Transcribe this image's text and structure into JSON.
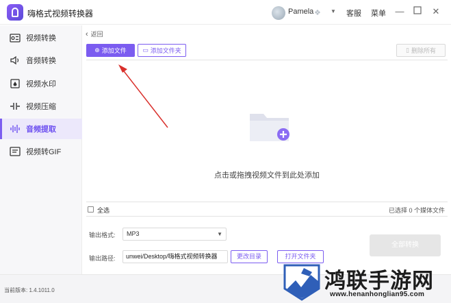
{
  "titlebar": {
    "app_title": "嗨格式视频转换器",
    "user_name": "Pamela",
    "vip_icon": "diamond-icon",
    "support_label": "客服",
    "menu_label": "菜单",
    "window_controls": [
      "minimize-icon",
      "maximize-icon",
      "close-icon"
    ]
  },
  "sidebar": {
    "items": [
      {
        "label": "视频转换",
        "icon": "video-convert-icon",
        "active": false
      },
      {
        "label": "音频转换",
        "icon": "speaker-icon",
        "active": false
      },
      {
        "label": "视频水印",
        "icon": "watermark-icon",
        "active": false
      },
      {
        "label": "视频压缩",
        "icon": "compress-icon",
        "active": false
      },
      {
        "label": "音频提取",
        "icon": "waveform-icon",
        "active": true
      },
      {
        "label": "视频转GIF",
        "icon": "gif-icon",
        "active": false
      }
    ]
  },
  "main": {
    "back_label": "返回",
    "add_file_label": "添加文件",
    "add_folder_label": "添加文件夹",
    "clear_all_label": "删除所有",
    "drop_hint": "点击或拖拽视频文件到此处添加",
    "select_all_label": "全选",
    "selected_count": "已选择 0 个媒体文件",
    "output_format_label": "输出格式:",
    "output_format_value": "MP3",
    "output_path_label": "输出路径:",
    "output_path_value": "unwei/Desktop/嗨格式视频转换器",
    "change_dir_label": "更改目录",
    "open_folder_label": "打开文件夹",
    "convert_all_label": "全部转换"
  },
  "status": {
    "version_label": "当前版本: 1.4.1011.0"
  },
  "watermark": {
    "title": "鸿联手游网",
    "url": "www.henanhonglian95.com"
  },
  "colors": {
    "accent": "#7b5cf0",
    "annotation_arrow": "#d9302c"
  }
}
